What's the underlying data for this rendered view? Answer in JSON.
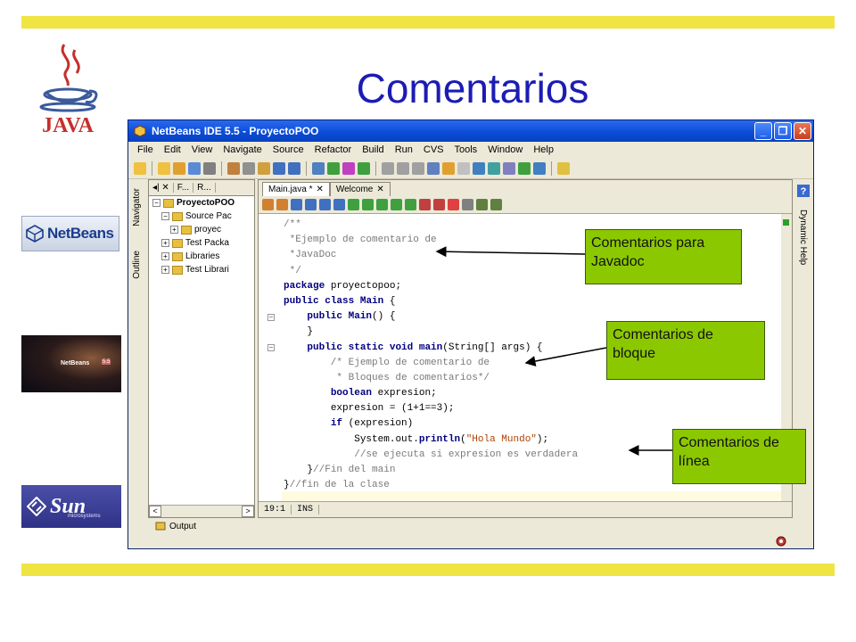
{
  "slide": {
    "title": "Comentarios",
    "colors": {
      "title": "#1c1cb4",
      "bars": "#f0e442",
      "callout": "#8cc800"
    }
  },
  "logos": {
    "java": "JAVA",
    "netbeans": "NetBeans",
    "nb55": "NetBeans",
    "nb55_version": "5.5",
    "sun": "Sun",
    "sun_sub": "microsystems"
  },
  "ide": {
    "window_title": "NetBeans IDE 5.5 - ProyectoPOO",
    "menu": [
      "File",
      "Edit",
      "View",
      "Navigate",
      "Source",
      "Refactor",
      "Build",
      "Run",
      "CVS",
      "Tools",
      "Window",
      "Help"
    ],
    "left_tabs": [
      "Navigator",
      "Outline"
    ],
    "right_tab": "Dynamic Help",
    "project_tabs": [
      "◂| ✕",
      "F...",
      "R..."
    ],
    "tree": [
      {
        "label": "ProyectoPOO",
        "indent": 0,
        "exp": "⊟"
      },
      {
        "label": "Source Pac",
        "indent": 1,
        "exp": "⊟"
      },
      {
        "label": "proyec",
        "indent": 2,
        "exp": "⊞"
      },
      {
        "label": "Test Packa",
        "indent": 1,
        "exp": "⊞"
      },
      {
        "label": "Libraries",
        "indent": 1,
        "exp": "⊞"
      },
      {
        "label": "Test Librari",
        "indent": 1,
        "exp": "⊞"
      }
    ],
    "editor_tabs": [
      {
        "label": "Main.java *",
        "active": true
      },
      {
        "label": "Welcome",
        "active": false
      }
    ],
    "code": [
      "/**",
      " *Ejemplo de comentario de",
      " *JavaDoc",
      " */",
      "package proyectopoo;",
      "public class Main {",
      "    public Main() {",
      "    }",
      "    public static void main(String[] args) {",
      "        /* Ejemplo de comentario de",
      "         * Bloques de comentarios*/",
      "        boolean expresion;",
      "        expresion = (1+1==3);",
      "        if (expresion)",
      "            System.out.println(\"Hola Mundo\");",
      "            //se ejecuta si expresion es verdadera",
      "    }//Fin del main",
      "}//fin de la clase"
    ],
    "status": {
      "position": "19:1",
      "mode": "INS"
    },
    "output_label": "Output"
  },
  "callouts": {
    "javadoc": "Comentarios para Javadoc",
    "block": "Comentarios de bloque",
    "line": "Comentarios de línea"
  }
}
